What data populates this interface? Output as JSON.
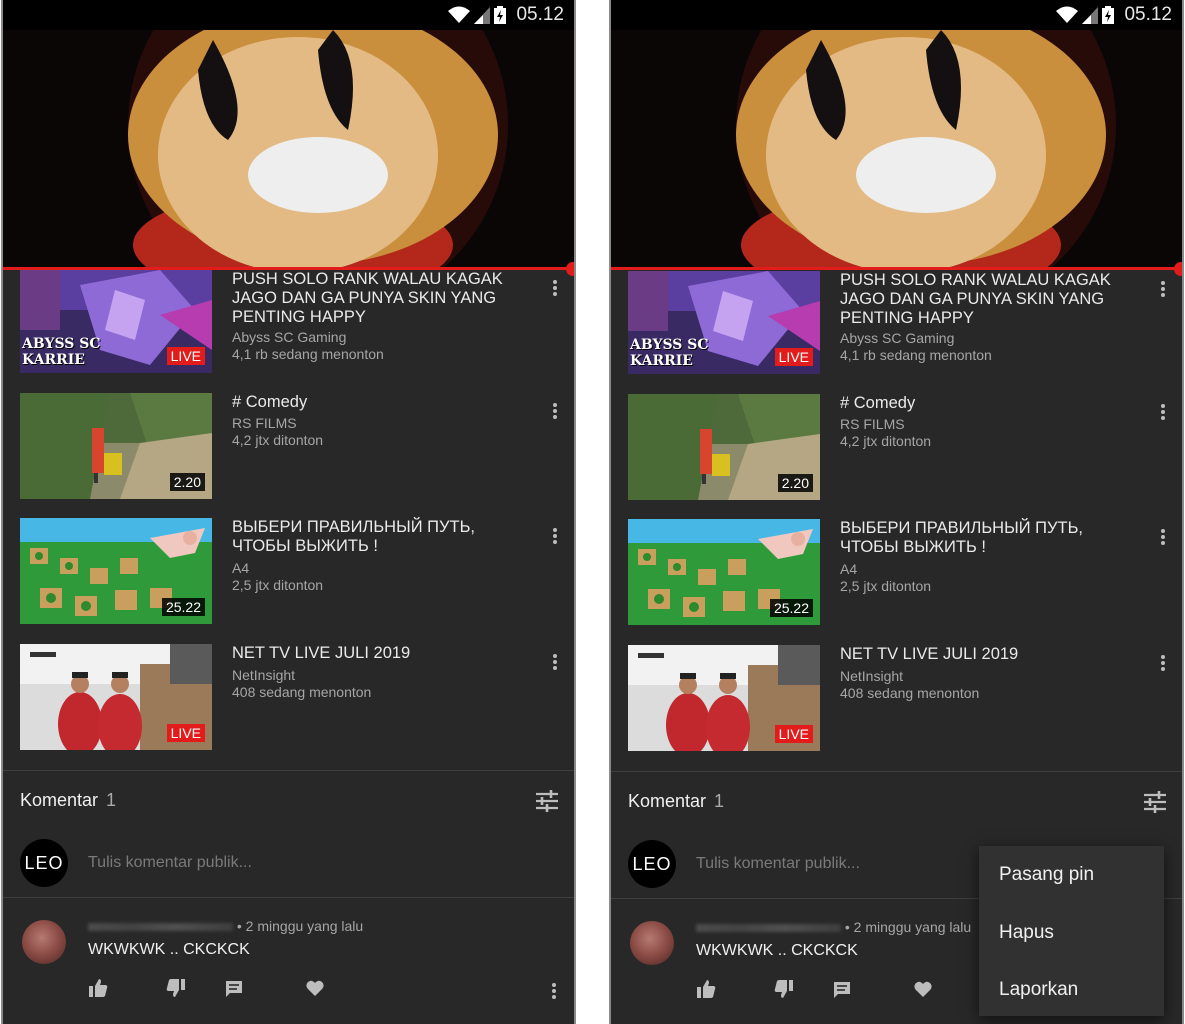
{
  "status_bar": {
    "time": "05.12"
  },
  "videos": [
    {
      "title": "PUSH  SOLO RANK WALAU KAGAK JAGO DAN GA PUNYA SKIN  YANG PENTING HAPPY",
      "channel": "Abyss SC Gaming",
      "stats": "4,1 rb sedang menonton",
      "badge": "LIVE",
      "thumb_text_1": "ABYSS SC",
      "thumb_text_2": "KARRIE"
    },
    {
      "title": "# Comedy",
      "channel": "RS FILMS",
      "stats": "4,2 jtx ditonton",
      "badge": "2.20"
    },
    {
      "title": "ВЫБЕРИ ПРАВИЛЬНЫЙ ПУТЬ, ЧТОБЫ ВЫЖИТЬ !",
      "channel": "A4",
      "stats": "2,5 jtx ditonton",
      "badge": "25.22"
    },
    {
      "title": "NET TV LIVE JULI 2019",
      "channel": "NetInsight",
      "stats": "408 sedang menonton",
      "badge": "LIVE"
    }
  ],
  "comments": {
    "header": "Komentar",
    "count": "1",
    "avatar_text": "LEO",
    "input_placeholder": "Tulis komentar publik...",
    "items": [
      {
        "time": "• 2 minggu yang lalu",
        "text": "WKWKWK .. CKCKCK"
      }
    ]
  },
  "menu": {
    "items": [
      "Pasang pin",
      "Hapus",
      "Laporkan"
    ]
  },
  "colors": {
    "accent": "#e21b1b",
    "background": "#282828",
    "text_secondary": "#a6a6a6"
  }
}
